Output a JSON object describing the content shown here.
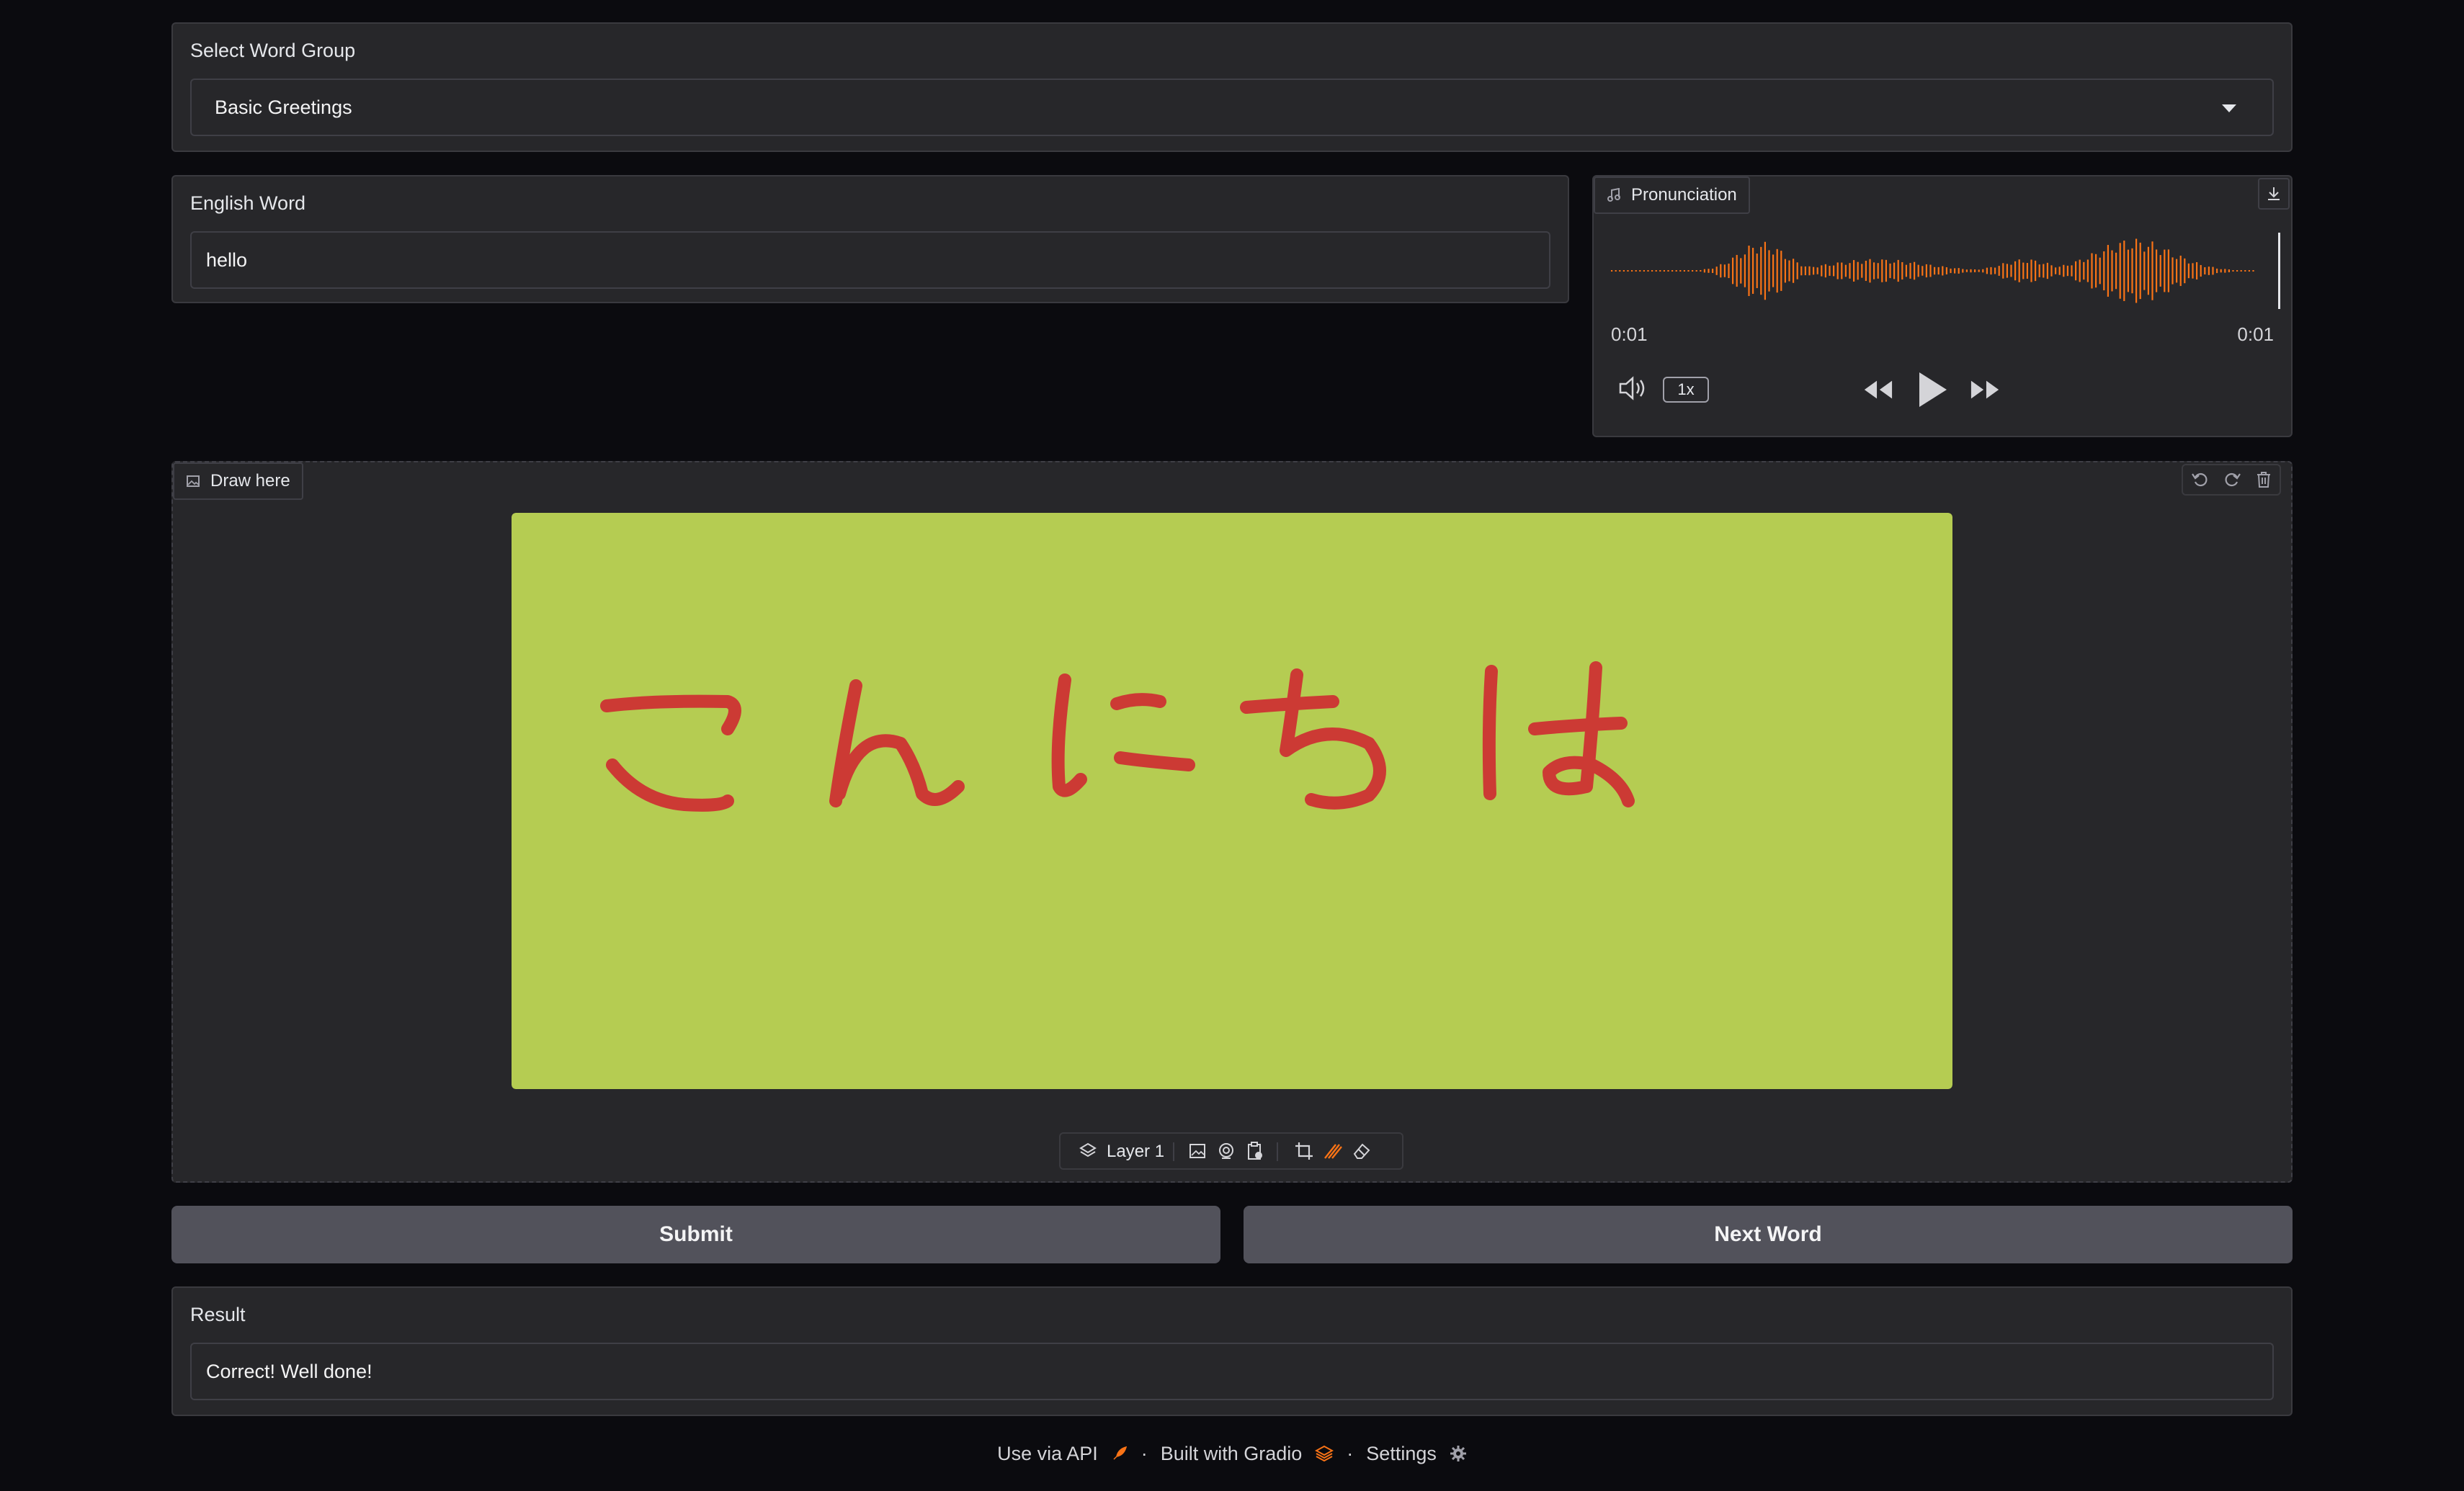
{
  "word_group": {
    "label": "Select Word Group",
    "selected": "Basic Greetings"
  },
  "english": {
    "label": "English Word",
    "value": "hello"
  },
  "audio": {
    "label": "Pronunciation",
    "current_time": "0:01",
    "duration": "0:01",
    "speed": "1x",
    "waveform_color": "#f97316"
  },
  "canvas": {
    "label": "Draw here",
    "background_color": "#b5cc52",
    "stroke_color": "#cc3a34",
    "drawn_text": "こんにちは",
    "layer_label": "Layer 1"
  },
  "actions": {
    "submit": "Submit",
    "next": "Next Word"
  },
  "result": {
    "label": "Result",
    "value": "Correct! Well done!"
  },
  "footer": {
    "api": "Use via API",
    "built": "Built with Gradio",
    "settings": "Settings",
    "separator": "·"
  },
  "colors": {
    "page_bg": "#0b0b0f",
    "panel_bg": "#27272a",
    "button_bg": "#52525b",
    "accent": "#f97316"
  }
}
